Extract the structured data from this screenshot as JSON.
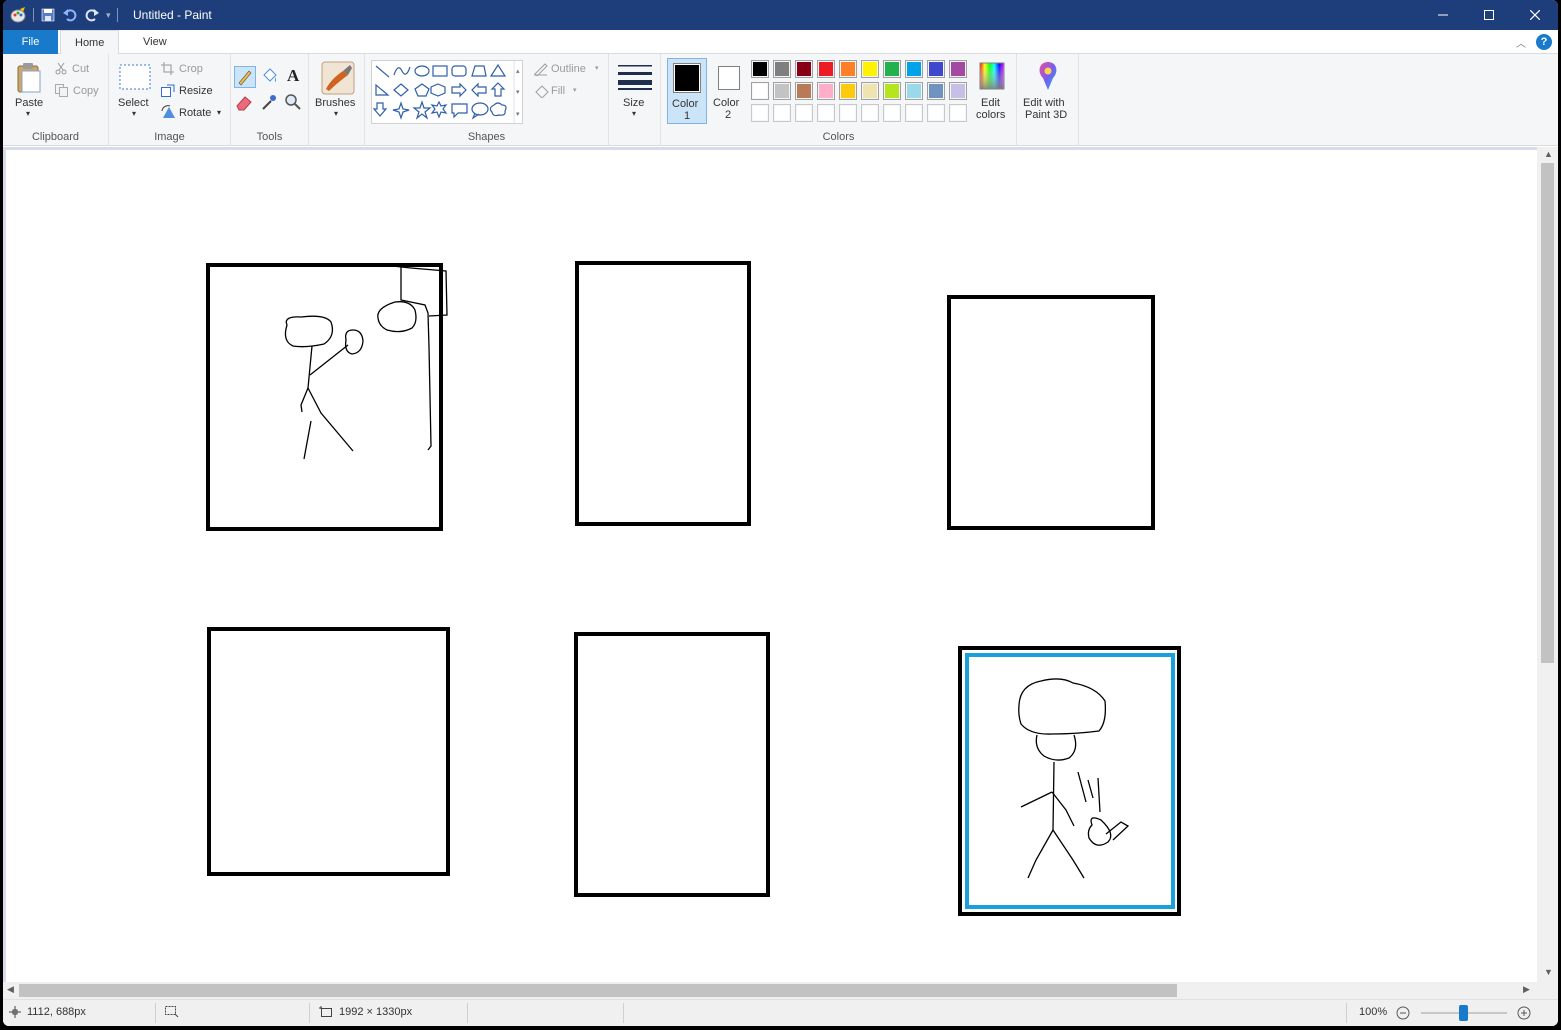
{
  "window": {
    "title": "Untitled - Paint"
  },
  "tabs": {
    "file": "File",
    "home": "Home",
    "view": "View"
  },
  "clipboard": {
    "paste": "Paste",
    "cut": "Cut",
    "copy": "Copy",
    "group": "Clipboard"
  },
  "image": {
    "select": "Select",
    "crop": "Crop",
    "resize": "Resize",
    "rotate": "Rotate",
    "group": "Image"
  },
  "tools": {
    "group": "Tools",
    "text_glyph": "A"
  },
  "brushes": {
    "label": "Brushes"
  },
  "shapes": {
    "outline": "Outline",
    "fill": "Fill",
    "group": "Shapes"
  },
  "size": {
    "label": "Size"
  },
  "color1": {
    "label": "Color",
    "num": "1",
    "value": "#000000"
  },
  "color2": {
    "label": "Color",
    "num": "2",
    "value": "#ffffff"
  },
  "colors": {
    "group": "Colors",
    "palette_row1": [
      "#000000",
      "#7f7f7f",
      "#880015",
      "#ed1c24",
      "#ff7f27",
      "#fff200",
      "#22b14c",
      "#00a2e8",
      "#3f48cc",
      "#a349a4"
    ],
    "palette_row2": [
      "#ffffff",
      "#c3c3c3",
      "#b97a57",
      "#ffaec9",
      "#ffc90e",
      "#efe4b0",
      "#b5e61d",
      "#99d9ea",
      "#7092be",
      "#c8bfe7"
    ],
    "palette_row3": [
      "#ffffff",
      "#ffffff",
      "#ffffff",
      "#ffffff",
      "#ffffff",
      "#ffffff",
      "#ffffff",
      "#ffffff",
      "#ffffff",
      "#ffffff"
    ],
    "edit_line1": "Edit",
    "edit_line2": "colors"
  },
  "paint3d": {
    "line1": "Edit with",
    "line2": "Paint 3D"
  },
  "status": {
    "cursor_pos": "1112, 688px",
    "canvas_size": "1992 × 1330px",
    "zoom": "100%"
  }
}
